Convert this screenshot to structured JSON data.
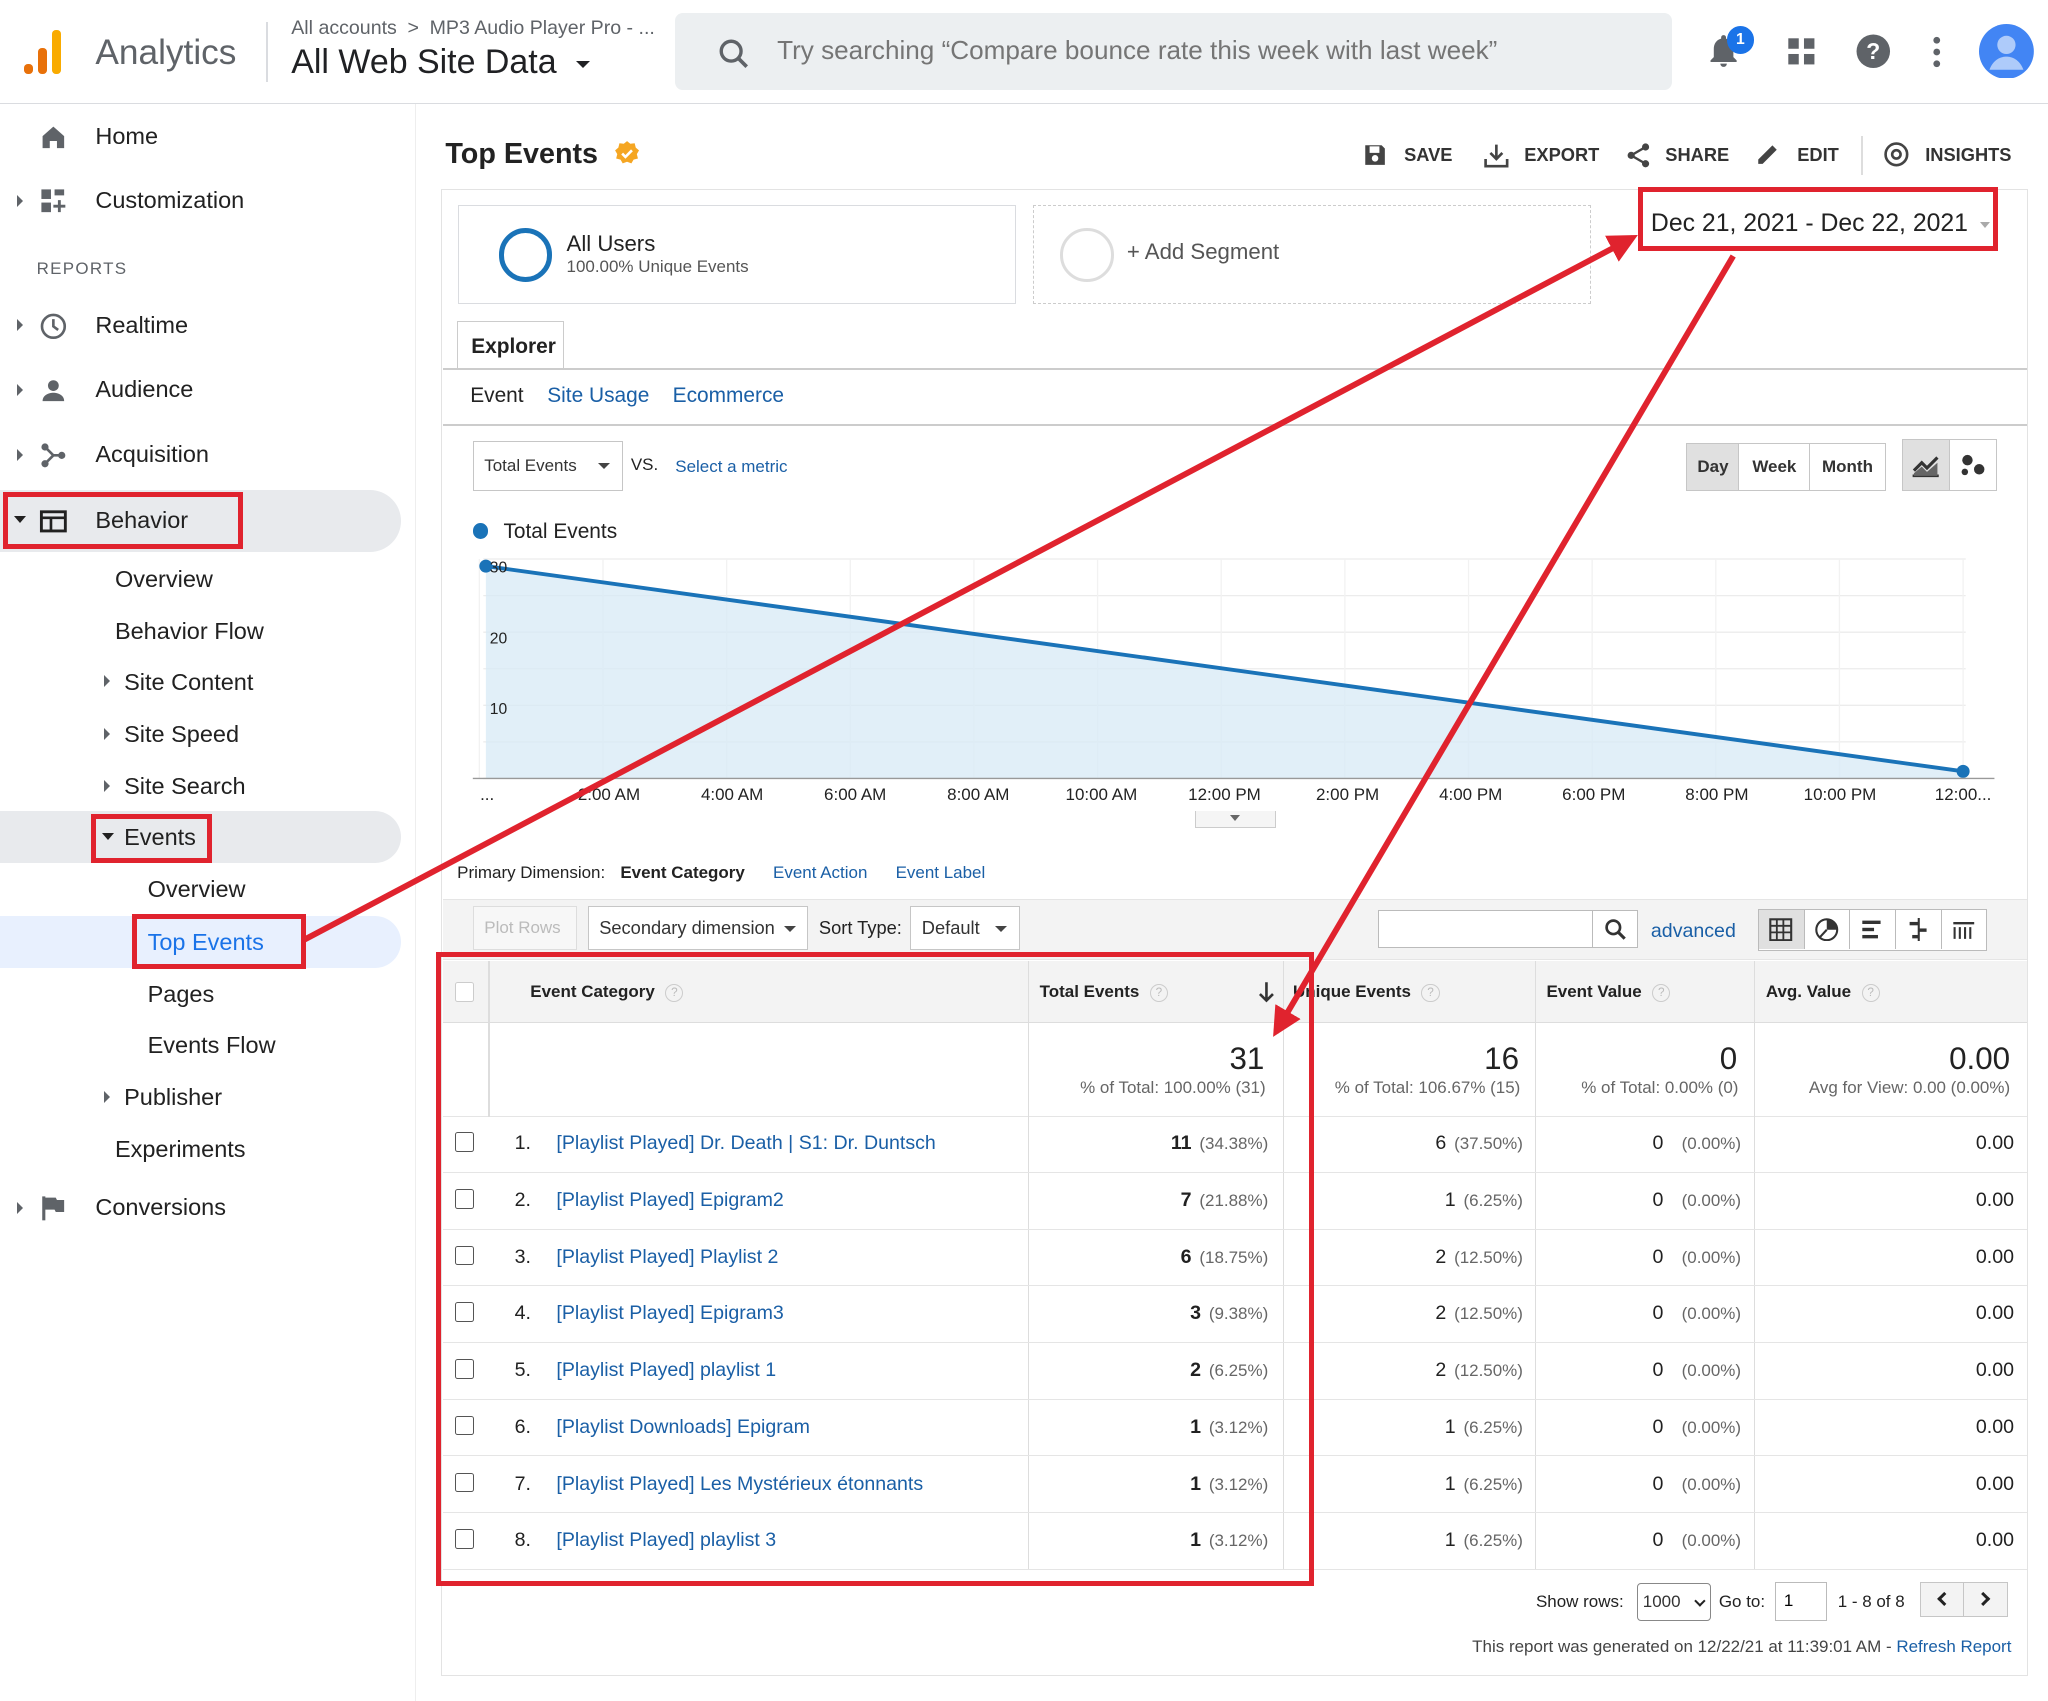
{
  "header": {
    "app_name": "Analytics",
    "breadcrumb_all": "All accounts",
    "breadcrumb_sep": ">",
    "breadcrumb_account": "MP3 Audio Player Pro - ...",
    "view_name": "All Web Site Data",
    "search_placeholder": "Try searching “Compare bounce rate this week with last week”",
    "notification_count": "1",
    "brand_color": "#f9ab00"
  },
  "sidebar": {
    "home": "Home",
    "customization": "Customization",
    "reports_heading": "REPORTS",
    "realtime": "Realtime",
    "audience": "Audience",
    "acquisition": "Acquisition",
    "behavior": "Behavior",
    "behavior_items": {
      "overview": "Overview",
      "behavior_flow": "Behavior Flow",
      "site_content": "Site Content",
      "site_speed": "Site Speed",
      "site_search": "Site Search",
      "events": "Events",
      "events_overview": "Overview",
      "top_events": "Top Events",
      "pages": "Pages",
      "events_flow": "Events Flow",
      "publisher": "Publisher",
      "experiments": "Experiments"
    },
    "conversions": "Conversions"
  },
  "page": {
    "title": "Top Events",
    "toolbar": {
      "save": "SAVE",
      "export": "EXPORT",
      "share": "SHARE",
      "edit": "EDIT",
      "insights": "INSIGHTS"
    },
    "segment": {
      "name": "All Users",
      "sub": "100.00% Unique Events",
      "add": "+ Add Segment"
    },
    "date_range": "Dec 21, 2021 - Dec 22, 2021",
    "explorer_tab": "Explorer",
    "subtabs": [
      "Event",
      "Site Usage",
      "Ecommerce"
    ],
    "metric_select": "Total Events",
    "vs": "VS.",
    "select_metric": "Select a metric",
    "granularity": [
      "Day",
      "Week",
      "Month"
    ],
    "accent_color": "#1a73e8",
    "highlight_color": "#e0232e"
  },
  "chart_data": {
    "type": "area",
    "series": [
      {
        "name": "Total Events",
        "x": [
          "12:00 AM",
          "12:00 AM"
        ],
        "values": [
          30,
          1
        ]
      }
    ],
    "y_ticks": [
      "10",
      "20",
      "30"
    ],
    "ylim": [
      0,
      31
    ],
    "x_ticks": [
      "...",
      "2:00 AM",
      "4:00 AM",
      "6:00 AM",
      "8:00 AM",
      "10:00 AM",
      "12:00 PM",
      "2:00 PM",
      "4:00 PM",
      "6:00 PM",
      "8:00 PM",
      "10:00 PM",
      "12:00..."
    ],
    "grid": true,
    "color": "#1a73b8"
  },
  "table_controls": {
    "primary_dimension_label": "Primary Dimension:",
    "primary_dimensions": [
      "Event Category",
      "Event Action",
      "Event Label"
    ],
    "plot_rows": "Plot Rows",
    "secondary_dimension": "Secondary dimension",
    "sort_type_label": "Sort Type:",
    "sort_type": "Default",
    "advanced": "advanced"
  },
  "table": {
    "headers": {
      "category": "Event Category",
      "total": "Total Events",
      "unique": "Unique Events",
      "value": "Event Value",
      "avg": "Avg. Value"
    },
    "totals": {
      "total": "31",
      "total_sub": "% of Total: 100.00% (31)",
      "unique": "16",
      "unique_sub": "% of Total: 106.67% (15)",
      "value": "0",
      "value_sub": "% of Total: 0.00% (0)",
      "avg": "0.00",
      "avg_sub": "Avg for View: 0.00 (0.00%)"
    },
    "rows": [
      {
        "n": "1.",
        "category": "[Playlist Played] Dr. Death | S1: Dr. Duntsch",
        "total": "11",
        "total_pct": "(34.38%)",
        "unique": "6",
        "unique_pct": "(37.50%)",
        "value": "0",
        "value_pct": "(0.00%)",
        "avg": "0.00"
      },
      {
        "n": "2.",
        "category": "[Playlist Played] Epigram2",
        "total": "7",
        "total_pct": "(21.88%)",
        "unique": "1",
        "unique_pct": "(6.25%)",
        "value": "0",
        "value_pct": "(0.00%)",
        "avg": "0.00"
      },
      {
        "n": "3.",
        "category": "[Playlist Played] Playlist 2",
        "total": "6",
        "total_pct": "(18.75%)",
        "unique": "2",
        "unique_pct": "(12.50%)",
        "value": "0",
        "value_pct": "(0.00%)",
        "avg": "0.00"
      },
      {
        "n": "4.",
        "category": "[Playlist Played] Epigram3",
        "total": "3",
        "total_pct": "(9.38%)",
        "unique": "2",
        "unique_pct": "(12.50%)",
        "value": "0",
        "value_pct": "(0.00%)",
        "avg": "0.00"
      },
      {
        "n": "5.",
        "category": "[Playlist Played] playlist 1",
        "total": "2",
        "total_pct": "(6.25%)",
        "unique": "2",
        "unique_pct": "(12.50%)",
        "value": "0",
        "value_pct": "(0.00%)",
        "avg": "0.00"
      },
      {
        "n": "6.",
        "category": "[Playlist Downloads] Epigram",
        "total": "1",
        "total_pct": "(3.12%)",
        "unique": "1",
        "unique_pct": "(6.25%)",
        "value": "0",
        "value_pct": "(0.00%)",
        "avg": "0.00"
      },
      {
        "n": "7.",
        "category": "[Playlist Played] Les Mystérieux étonnants",
        "total": "1",
        "total_pct": "(3.12%)",
        "unique": "1",
        "unique_pct": "(6.25%)",
        "value": "0",
        "value_pct": "(0.00%)",
        "avg": "0.00"
      },
      {
        "n": "8.",
        "category": "[Playlist Played] playlist 3",
        "total": "1",
        "total_pct": "(3.12%)",
        "unique": "1",
        "unique_pct": "(6.25%)",
        "value": "0",
        "value_pct": "(0.00%)",
        "avg": "0.00"
      }
    ]
  },
  "footer": {
    "show_rows_label": "Show rows:",
    "show_rows": "1000",
    "goto_label": "Go to:",
    "goto_value": "1",
    "range": "1 - 8 of 8",
    "generated": "This report was generated on 12/22/21 at 11:39:01 AM -",
    "refresh": "Refresh Report"
  }
}
